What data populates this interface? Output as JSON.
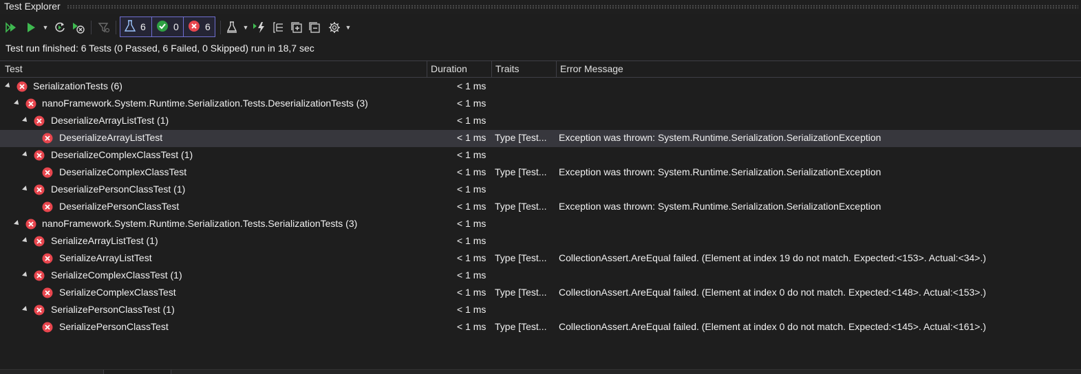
{
  "window": {
    "title": "Test Explorer"
  },
  "toolbar": {
    "counters": {
      "total": "6",
      "passed": "0",
      "failed": "6"
    },
    "colors": {
      "run_green": "#3fb950",
      "passed_green": "#2ea043",
      "failed_red": "#e8464e",
      "counter_border": "#6f6fd0"
    }
  },
  "status": {
    "text": "Test run finished: 6 Tests (0 Passed, 6 Failed, 0 Skipped) run in 18,7 sec"
  },
  "columns": {
    "test": "Test",
    "duration": "Duration",
    "traits": "Traits",
    "error": "Error Message"
  },
  "rows": [
    {
      "name": "SerializationTests  (6)",
      "duration": "< 1 ms",
      "traits": "",
      "error": ""
    },
    {
      "name": "nanoFramework.System.Runtime.Serialization.Tests.DeserializationTests  (3)",
      "duration": "< 1 ms",
      "traits": "",
      "error": ""
    },
    {
      "name": "DeserializeArrayListTest  (1)",
      "duration": "< 1 ms",
      "traits": "",
      "error": ""
    },
    {
      "name": "DeserializeArrayListTest",
      "duration": "< 1 ms",
      "traits": "Type [Test...",
      "error": "Exception was thrown: System.Runtime.Serialization.SerializationException"
    },
    {
      "name": "DeserializeComplexClassTest  (1)",
      "duration": "< 1 ms",
      "traits": "",
      "error": ""
    },
    {
      "name": "DeserializeComplexClassTest",
      "duration": "< 1 ms",
      "traits": "Type [Test...",
      "error": "Exception was thrown: System.Runtime.Serialization.SerializationException"
    },
    {
      "name": "DeserializePersonClassTest  (1)",
      "duration": "< 1 ms",
      "traits": "",
      "error": ""
    },
    {
      "name": "DeserializePersonClassTest",
      "duration": "< 1 ms",
      "traits": "Type [Test...",
      "error": "Exception was thrown: System.Runtime.Serialization.SerializationException"
    },
    {
      "name": "nanoFramework.System.Runtime.Serialization.Tests.SerializationTests  (3)",
      "duration": "< 1 ms",
      "traits": "",
      "error": ""
    },
    {
      "name": "SerializeArrayListTest  (1)",
      "duration": "< 1 ms",
      "traits": "",
      "error": ""
    },
    {
      "name": "SerializeArrayListTest",
      "duration": "< 1 ms",
      "traits": "Type [Test...",
      "error": "CollectionAssert.AreEqual failed. (Element at index 19 do not match. Expected:<153>. Actual:<34>.)"
    },
    {
      "name": "SerializeComplexClassTest  (1)",
      "duration": "< 1 ms",
      "traits": "",
      "error": ""
    },
    {
      "name": "SerializeComplexClassTest",
      "duration": "< 1 ms",
      "traits": "Type [Test...",
      "error": "CollectionAssert.AreEqual failed. (Element at index 0 do not match. Expected:<148>. Actual:<153>.)"
    },
    {
      "name": "SerializePersonClassTest  (1)",
      "duration": "< 1 ms",
      "traits": "",
      "error": ""
    },
    {
      "name": "SerializePersonClassTest",
      "duration": "< 1 ms",
      "traits": "Type [Test...",
      "error": "CollectionAssert.AreEqual failed. (Element at index 0 do not match. Expected:<145>. Actual:<161>.)"
    }
  ]
}
